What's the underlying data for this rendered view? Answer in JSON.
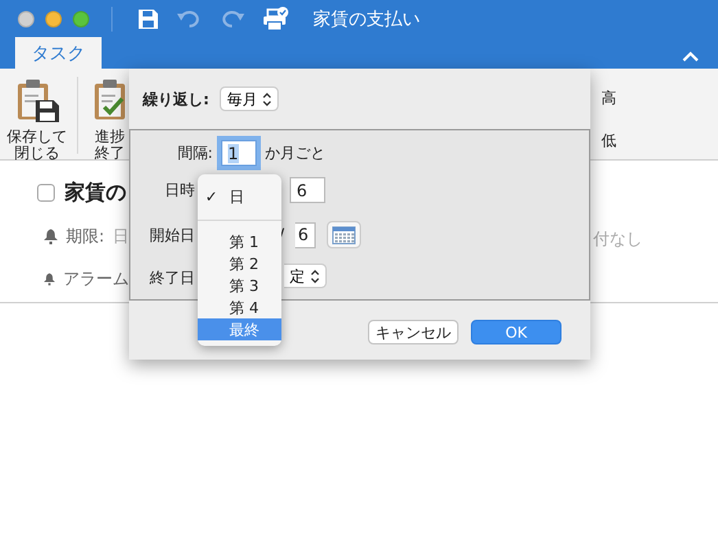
{
  "window": {
    "title": "家賃の支払い",
    "traffic_lights": [
      {
        "color": "#d0d0d0"
      },
      {
        "color": "#f5b93b"
      },
      {
        "color": "#5ac43d"
      }
    ],
    "toolbar": [
      {
        "kind": "save",
        "disabled": false
      },
      {
        "kind": "undo",
        "disabled": true
      },
      {
        "kind": "redo",
        "disabled": true
      },
      {
        "kind": "print",
        "disabled": false
      }
    ]
  },
  "tabs": [
    {
      "label": "タスク",
      "selected": true
    }
  ],
  "ribbon": {
    "buttons": [
      {
        "kind": "save-close",
        "lines": [
          "保存して",
          "閉じる"
        ]
      },
      {
        "kind": "progress",
        "lines": [
          "進捗",
          "終了"
        ]
      }
    ],
    "priority": [
      "高",
      "低"
    ]
  },
  "task": {
    "title": "家賃の",
    "checked": false,
    "due_label": "期限:",
    "due_value": "日",
    "due_right": "付なし",
    "alarm_label": "アラーム"
  },
  "sheet": {
    "repeat_label": "繰り返し:",
    "repeat_value": "毎月",
    "interval_label": "間隔:",
    "interval_value": "1",
    "interval_unit": "か月ごと",
    "day_label": "日時",
    "day_value": "6",
    "start_label": "開始日",
    "start_separator": "/",
    "start_day": "6",
    "end_label": "終了日",
    "end_value": "定",
    "buttons": [
      {
        "label": "キャンセル",
        "default": false
      },
      {
        "label": "OK",
        "default": true
      }
    ]
  },
  "menu_check_mark": "✓",
  "menu": [
    {
      "kind": "item",
      "label": "日",
      "checked": true,
      "selected": false
    },
    {
      "kind": "separator"
    },
    {
      "kind": "item",
      "label": "第 1",
      "checked": false,
      "selected": false
    },
    {
      "kind": "item",
      "label": "第 2",
      "checked": false,
      "selected": false
    },
    {
      "kind": "item",
      "label": "第 3",
      "checked": false,
      "selected": false
    },
    {
      "kind": "item",
      "label": "第 4",
      "checked": false,
      "selected": false
    },
    {
      "kind": "item",
      "label": "最終",
      "checked": false,
      "selected": true
    }
  ]
}
